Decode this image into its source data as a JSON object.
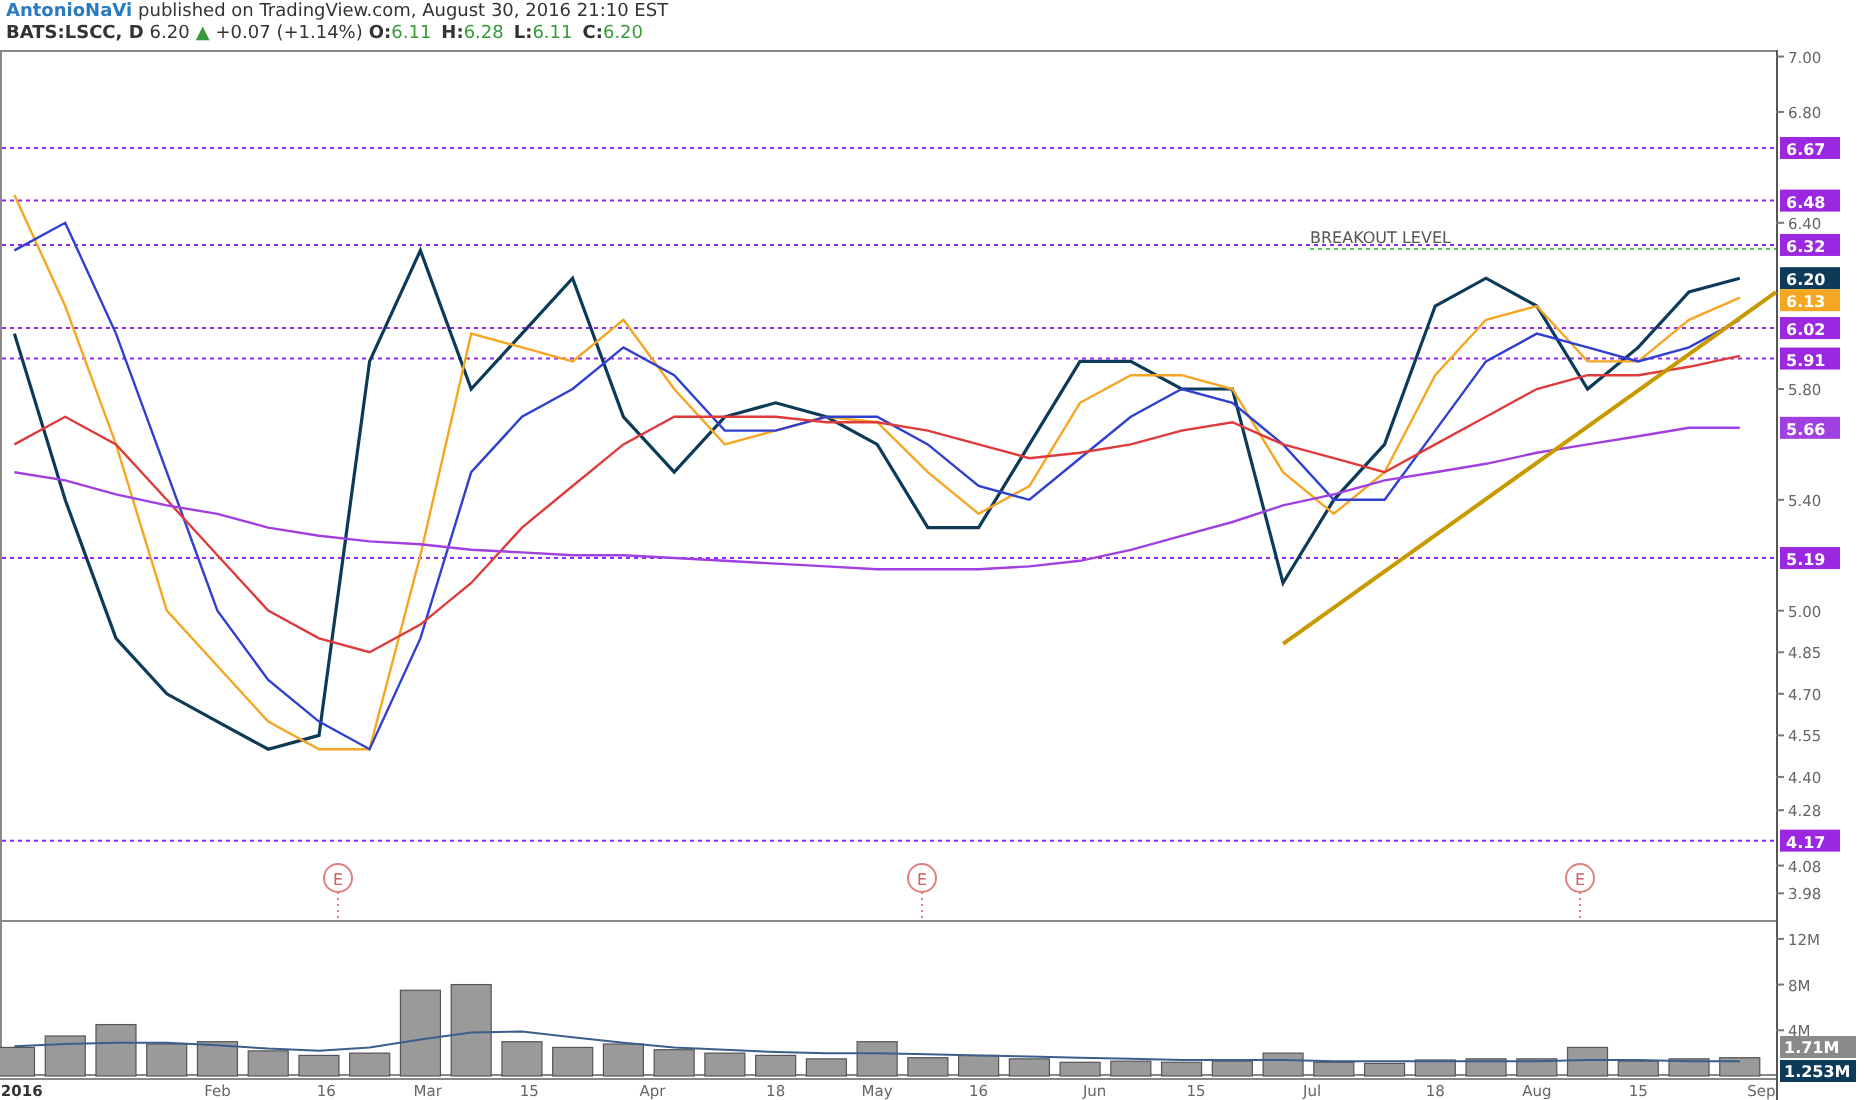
{
  "header": {
    "author": "AntonioNaVi",
    "published": "published on TradingView.com, August 30, 2016 21:10 EST"
  },
  "quote": {
    "symbol": "BATS:LSCC, D",
    "last": "6.20",
    "arrow": "▲",
    "change": "+0.07 (+1.14%)",
    "ohlc": [
      {
        "label": "O:",
        "value": "6.11"
      },
      {
        "label": "H:",
        "value": "6.28"
      },
      {
        "label": "L:",
        "value": "6.11"
      },
      {
        "label": "C:",
        "value": "6.20"
      }
    ]
  },
  "price_chart": {
    "chart_data": {
      "type": "line",
      "x": [
        "2016-01-04",
        "2016-01-11",
        "2016-01-18",
        "2016-01-25",
        "2016-02-01",
        "2016-02-08",
        "2016-02-15",
        "2016-02-22",
        "2016-02-29",
        "2016-03-07",
        "2016-03-14",
        "2016-03-21",
        "2016-03-28",
        "2016-04-04",
        "2016-04-11",
        "2016-04-18",
        "2016-04-25",
        "2016-05-02",
        "2016-05-09",
        "2016-05-16",
        "2016-05-23",
        "2016-05-30",
        "2016-06-06",
        "2016-06-13",
        "2016-06-20",
        "2016-06-27",
        "2016-07-04",
        "2016-07-11",
        "2016-07-18",
        "2016-07-25",
        "2016-08-01",
        "2016-08-08",
        "2016-08-15",
        "2016-08-22",
        "2016-08-29"
      ],
      "xlim": [
        "2016-01-02",
        "2016-09-03"
      ],
      "series": [
        {
          "color": "#0d3a58",
          "values": [
            6.0,
            5.4,
            4.9,
            4.7,
            4.6,
            4.5,
            4.55,
            5.9,
            6.3,
            5.8,
            6.0,
            6.2,
            5.7,
            5.5,
            5.7,
            5.75,
            5.7,
            5.6,
            5.3,
            5.3,
            5.6,
            5.9,
            5.9,
            5.8,
            5.8,
            5.1,
            5.4,
            5.6,
            6.1,
            6.2,
            6.1,
            5.8,
            5.95,
            6.15,
            6.2
          ]
        },
        {
          "color": "#f5a623",
          "values": [
            6.5,
            6.1,
            5.6,
            5.0,
            4.8,
            4.6,
            4.5,
            4.5,
            5.2,
            6.0,
            5.95,
            5.9,
            6.05,
            5.8,
            5.6,
            5.65,
            5.7,
            5.68,
            5.5,
            5.35,
            5.45,
            5.75,
            5.85,
            5.85,
            5.8,
            5.5,
            5.35,
            5.5,
            5.85,
            6.05,
            6.1,
            5.9,
            5.9,
            6.05,
            6.13
          ]
        },
        {
          "color": "#2f3fd0",
          "values": [
            6.3,
            6.4,
            6.0,
            5.5,
            5.0,
            4.75,
            4.6,
            4.5,
            4.9,
            5.5,
            5.7,
            5.8,
            5.95,
            5.85,
            5.65,
            5.65,
            5.7,
            5.7,
            5.6,
            5.45,
            5.4,
            5.55,
            5.7,
            5.8,
            5.75,
            5.6,
            5.4,
            5.4,
            5.65,
            5.9,
            6.0,
            5.95,
            5.9,
            5.95,
            6.05
          ]
        },
        {
          "color": "#e03b3b",
          "values": [
            5.6,
            5.7,
            5.6,
            5.4,
            5.2,
            5.0,
            4.9,
            4.85,
            4.95,
            5.1,
            5.3,
            5.45,
            5.6,
            5.7,
            5.7,
            5.7,
            5.68,
            5.68,
            5.65,
            5.6,
            5.55,
            5.57,
            5.6,
            5.65,
            5.68,
            5.6,
            5.55,
            5.5,
            5.6,
            5.7,
            5.8,
            5.85,
            5.85,
            5.88,
            5.92
          ]
        },
        {
          "color": "#a040e0",
          "values": [
            5.5,
            5.47,
            5.42,
            5.38,
            5.35,
            5.3,
            5.27,
            5.25,
            5.24,
            5.22,
            5.21,
            5.2,
            5.2,
            5.19,
            5.18,
            5.17,
            5.16,
            5.15,
            5.15,
            5.15,
            5.16,
            5.18,
            5.22,
            5.27,
            5.32,
            5.38,
            5.42,
            5.47,
            5.5,
            5.53,
            5.57,
            5.6,
            5.63,
            5.66,
            5.66
          ]
        }
      ],
      "ylim": [
        3.88,
        7.02
      ],
      "yticks": [
        {
          "value": 7.0,
          "label": "7.00"
        },
        {
          "value": 6.8,
          "label": "6.80"
        },
        {
          "value": 6.4,
          "label": "6.40"
        },
        {
          "value": 5.8,
          "label": "5.80"
        },
        {
          "value": 5.4,
          "label": "5.40"
        },
        {
          "value": 5.0,
          "label": "5.00"
        },
        {
          "value": 4.85,
          "label": "4.85"
        },
        {
          "value": 4.7,
          "label": "4.70"
        },
        {
          "value": 4.55,
          "label": "4.55"
        },
        {
          "value": 4.4,
          "label": "4.40"
        },
        {
          "value": 4.28,
          "label": "4.28"
        },
        {
          "value": 4.08,
          "label": "4.08"
        },
        {
          "value": 3.98,
          "label": "3.98"
        }
      ],
      "ref_lines": [
        {
          "axis": "y",
          "value": 6.67,
          "label": "6.67"
        },
        {
          "axis": "y",
          "value": 6.48,
          "label": "6.48"
        },
        {
          "axis": "y",
          "value": 6.32,
          "label": "6.32"
        },
        {
          "axis": "y",
          "value": 6.02,
          "label": "6.02"
        },
        {
          "axis": "y",
          "value": 5.91,
          "label": "5.91"
        },
        {
          "axis": "y",
          "value": 5.19,
          "label": "5.19"
        },
        {
          "axis": "y",
          "value": 4.17,
          "label": "4.17"
        }
      ],
      "annotations": [
        "6.20",
        "6.13",
        "5.66",
        "BREAKOUT LEVEL",
        "E",
        "E",
        "E"
      ]
    }
  },
  "volume_chart": {
    "chart_data": {
      "type": "bar",
      "x": [
        "2016-01-04",
        "2016-01-11",
        "2016-01-18",
        "2016-01-25",
        "2016-02-01",
        "2016-02-08",
        "2016-02-15",
        "2016-02-22",
        "2016-02-29",
        "2016-03-07",
        "2016-03-14",
        "2016-03-21",
        "2016-03-28",
        "2016-04-04",
        "2016-04-11",
        "2016-04-18",
        "2016-04-25",
        "2016-05-02",
        "2016-05-09",
        "2016-05-16",
        "2016-05-23",
        "2016-05-30",
        "2016-06-06",
        "2016-06-13",
        "2016-06-20",
        "2016-06-27",
        "2016-07-04",
        "2016-07-11",
        "2016-07-18",
        "2016-07-25",
        "2016-08-01",
        "2016-08-08",
        "2016-08-15",
        "2016-08-22",
        "2016-08-29"
      ],
      "xlim": [
        "2016-01-02",
        "2016-09-03"
      ],
      "series": [
        {
          "color": "#9a9a9a",
          "values": [
            2.5,
            3.5,
            4.5,
            2.8,
            3.0,
            2.2,
            1.8,
            2.0,
            7.5,
            8.0,
            3.0,
            2.5,
            2.8,
            2.3,
            2.0,
            1.8,
            1.5,
            3.0,
            1.6,
            1.8,
            1.5,
            1.2,
            1.3,
            1.2,
            1.3,
            2.0,
            1.2,
            1.1,
            1.4,
            1.5,
            1.5,
            2.5,
            1.3,
            1.5,
            1.6
          ]
        },
        {
          "type": "line",
          "color": "#3b5f8a",
          "values": [
            2.6,
            2.8,
            2.9,
            2.9,
            2.7,
            2.4,
            2.2,
            2.5,
            3.2,
            3.8,
            3.9,
            3.4,
            2.9,
            2.5,
            2.3,
            2.1,
            2.0,
            2.0,
            1.9,
            1.8,
            1.7,
            1.6,
            1.5,
            1.4,
            1.4,
            1.4,
            1.3,
            1.3,
            1.3,
            1.3,
            1.3,
            1.4,
            1.4,
            1.3,
            1.3
          ]
        }
      ],
      "ylim": [
        0,
        14
      ],
      "yticks": [
        {
          "value": 4,
          "label": "4M"
        },
        {
          "value": 8,
          "label": "8M"
        },
        {
          "value": 12,
          "label": "12M"
        }
      ],
      "xticks": [
        {
          "value": "2016-01-05",
          "label": "2016"
        },
        {
          "value": "2016-02-01",
          "label": "Feb"
        },
        {
          "value": "2016-02-16",
          "label": "16"
        },
        {
          "value": "2016-03-01",
          "label": "Mar"
        },
        {
          "value": "2016-03-15",
          "label": "15"
        },
        {
          "value": "2016-04-01",
          "label": "Apr"
        },
        {
          "value": "2016-04-18",
          "label": "18"
        },
        {
          "value": "2016-05-02",
          "label": "May"
        },
        {
          "value": "2016-05-16",
          "label": "16"
        },
        {
          "value": "2016-06-01",
          "label": "Jun"
        },
        {
          "value": "2016-06-15",
          "label": "15"
        },
        {
          "value": "2016-07-01",
          "label": "Jul"
        },
        {
          "value": "2016-07-18",
          "label": "18"
        },
        {
          "value": "2016-08-01",
          "label": "Aug"
        },
        {
          "value": "2016-08-15",
          "label": "15"
        },
        {
          "value": "2016-09-01",
          "label": "Sep"
        }
      ]
    },
    "axis_labels": [
      {
        "label": "1.71M",
        "color": "#8a8a8a"
      },
      {
        "label": "1.253M",
        "color": "#0d3a58"
      }
    ]
  }
}
